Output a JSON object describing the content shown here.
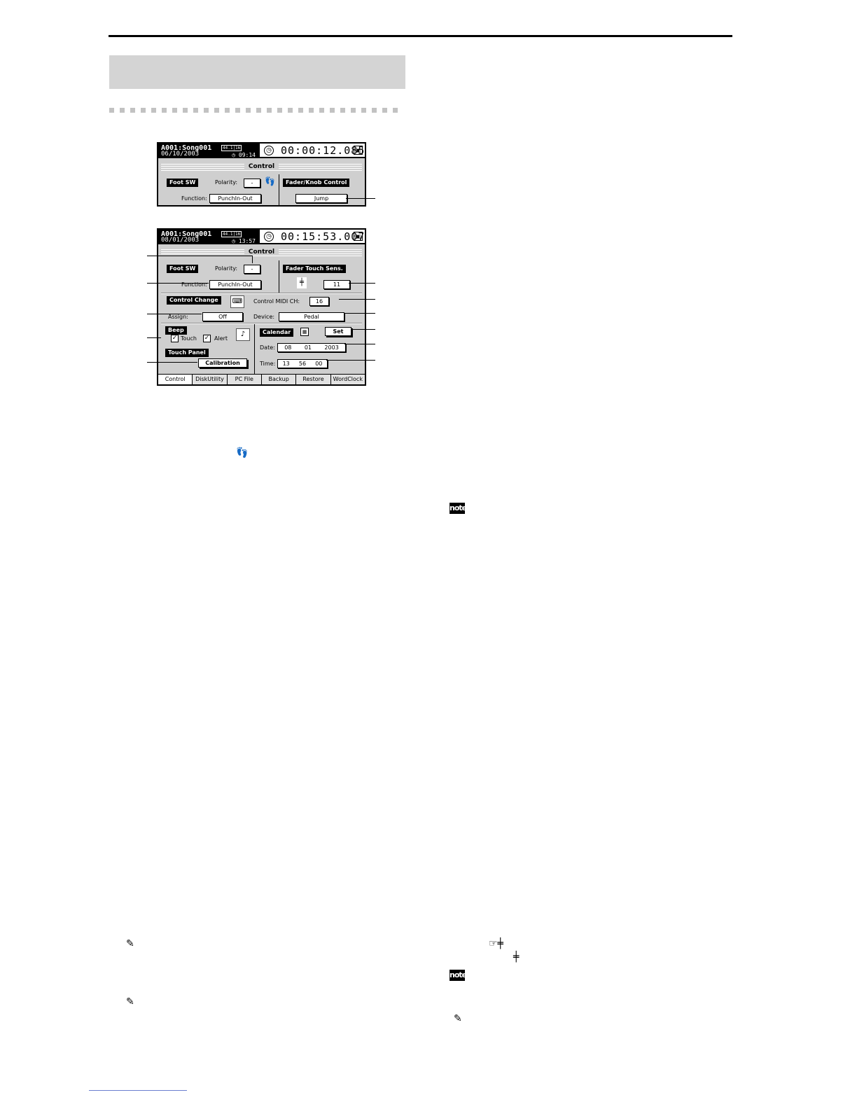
{
  "screen1": {
    "song": "A001:Song001",
    "rate": "44.1|16",
    "date": "06/10/2003",
    "clock": "◷ 09:14",
    "counter": "00:00:12.085",
    "section_title": "Control",
    "foot_sw_label": "Foot SW",
    "polarity_label": "Polarity:",
    "polarity_value": "-",
    "function_label": "Function:",
    "function_value": "PunchIn-Out",
    "fader_knob_label": "Fader/Knob Control",
    "fader_knob_value": "Jump"
  },
  "screen2": {
    "song": "A001:Song001",
    "rate": "44.1|16",
    "date": "08/01/2003",
    "clock": "◷ 13:57",
    "counter": "00:15:53.007",
    "section_title": "Control",
    "foot_sw_label": "Foot SW",
    "polarity_label": "Polarity:",
    "polarity_value": "-",
    "function_label": "Function:",
    "function_value": "PunchIn-Out",
    "fader_touch_label": "Fader Touch Sens.",
    "fader_touch_value": "11",
    "control_change_label": "Control Change",
    "assign_label": "Assign:",
    "assign_value": "Off",
    "control_midi_label": "Control MIDI CH:",
    "control_midi_value": "16",
    "device_label": "Device:",
    "device_value": "Pedal",
    "beep_label": "Beep",
    "touch_label": "Touch",
    "alert_label": "Alert",
    "touch_panel_label": "Touch Panel",
    "calibration_label": "Calibration",
    "calendar_label": "Calendar",
    "set_label": "Set",
    "date_label": "Date:",
    "date_month": "08",
    "date_day": "01",
    "date_year": "2003",
    "time_label": "Time:",
    "time_hour": "13",
    "time_min": "56",
    "time_sec": "00",
    "tabs": [
      "Control",
      "DiskUtility",
      "PC File",
      "Backup",
      "Restore",
      "WordClock"
    ]
  },
  "icons": {
    "footprint": "footprint-icon",
    "note": "note",
    "caution": "caution-icon",
    "touch_hand": "touch-hand-icon",
    "fader": "fader-icon"
  }
}
